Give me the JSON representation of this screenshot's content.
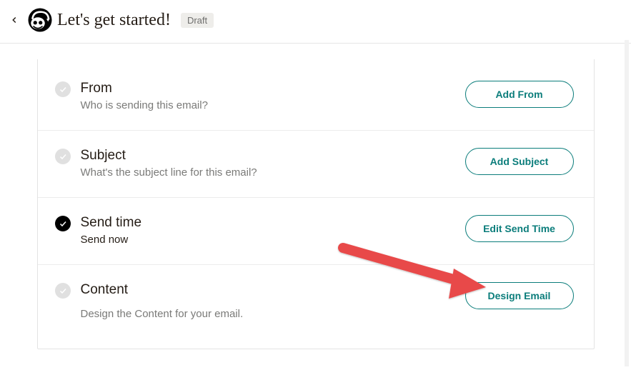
{
  "header": {
    "title": "Let's get started!",
    "badge": "Draft"
  },
  "rows": {
    "from": {
      "title": "From",
      "sub": "Who is sending this email?",
      "button": "Add From"
    },
    "subject": {
      "title": "Subject",
      "sub": "What's the subject line for this email?",
      "button": "Add Subject"
    },
    "sendtime": {
      "title": "Send time",
      "sub": "Send now",
      "button": "Edit Send Time"
    },
    "content": {
      "title": "Content",
      "sub": "Design the Content for your email.",
      "button": "Design Email"
    }
  }
}
